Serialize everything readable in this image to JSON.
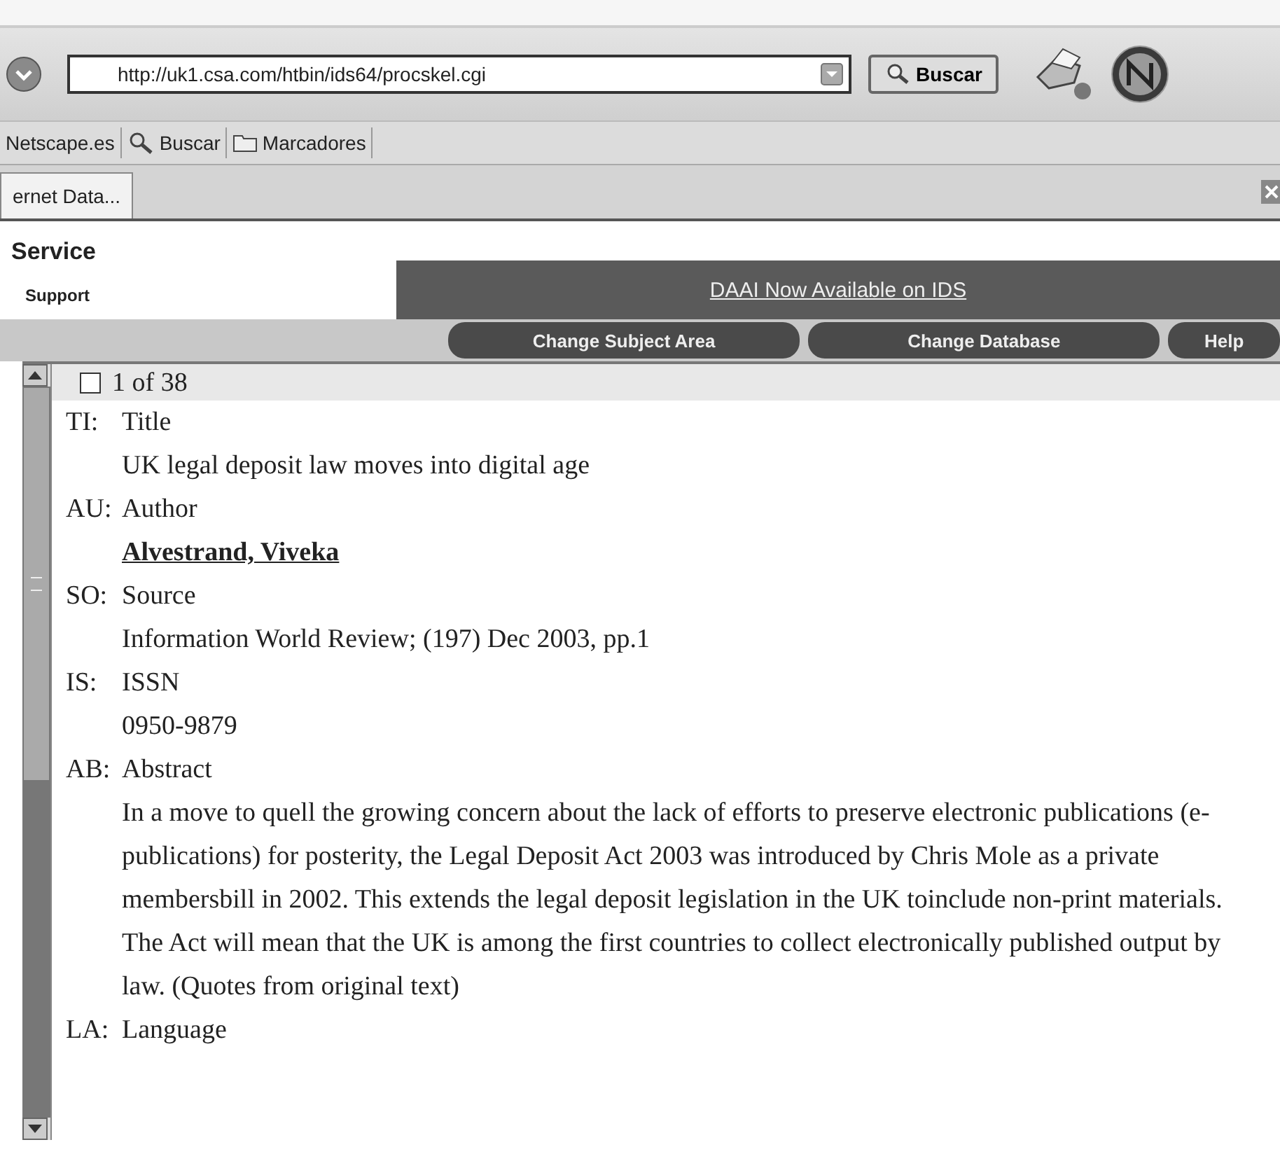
{
  "toolbar": {
    "url": "http://uk1.csa.com/htbin/ids64/procskel.cgi",
    "search_button": "Buscar"
  },
  "bookmarks": [
    {
      "label": "Netscape.es",
      "kind": "text"
    },
    {
      "label": "Buscar",
      "kind": "search"
    },
    {
      "label": "Marcadores",
      "kind": "folder"
    }
  ],
  "tabs": [
    {
      "label": "ernet Data...",
      "selected": true
    }
  ],
  "page": {
    "brand": "Service",
    "subbrand": "Support",
    "banner_link": "DAAI Now Available on IDS",
    "nav_buttons": [
      "Change Subject Area",
      "Change Database",
      "Help"
    ],
    "record": {
      "counter": "1 of 38",
      "checked": false,
      "fields": [
        {
          "code": "TI:",
          "label": "Title",
          "value": "UK legal deposit law moves into digital age",
          "kind": "text"
        },
        {
          "code": "AU:",
          "label": "Author",
          "value": "Alvestrand, Viveka",
          "kind": "link"
        },
        {
          "code": "SO:",
          "label": "Source",
          "value": "Information World Review; (197) Dec 2003, pp.1",
          "kind": "text"
        },
        {
          "code": "IS:",
          "label": "ISSN",
          "value": "0950-9879",
          "kind": "text"
        },
        {
          "code": "AB:",
          "label": "Abstract",
          "value": "In a move to quell the growing concern about the lack of efforts to preserve electronic publications (e-publications) for posterity, the Legal Deposit Act 2003 was introduced by Chris Mole as a private membersbill in 2002. This extends the legal deposit legislation in the UK toinclude non-print materials. The Act will mean that the UK is among the first countries to collect electronically published output by law. (Quotes from original text)",
          "kind": "text"
        },
        {
          "code": "LA:",
          "label": "Language"
        }
      ]
    }
  }
}
